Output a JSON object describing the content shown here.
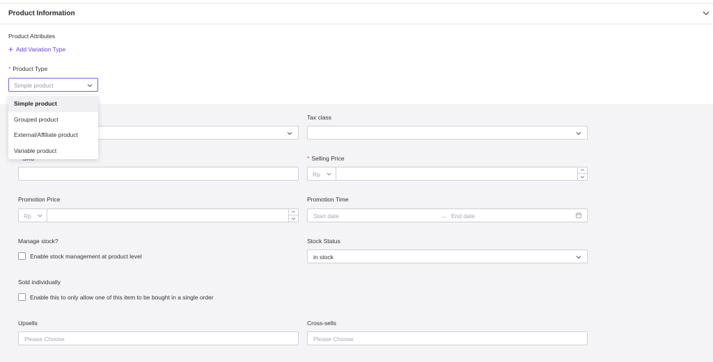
{
  "header": {
    "title": "Product Information"
  },
  "attributes": {
    "label": "Product Attributes",
    "add_variation": "Add Variation Type"
  },
  "product_type": {
    "label": "Product Type",
    "placeholder": "Simple product",
    "options": [
      "Simple product",
      "Grouped product",
      "External/Affiliate product",
      "Variable product"
    ],
    "highlighted": "Simple product"
  },
  "tax_class": {
    "label": "Tax class",
    "value": ""
  },
  "sku": {
    "label": "SKU",
    "value": ""
  },
  "selling_price": {
    "label": "Selling Price",
    "currency": "Rp",
    "value": ""
  },
  "promotion_price": {
    "label": "Promotion Price",
    "currency": "Rp",
    "value": ""
  },
  "promotion_time": {
    "label": "Promotion Time",
    "start_placeholder": "Start date",
    "arrow": "→",
    "end_placeholder": "End date"
  },
  "manage_stock": {
    "label": "Manage stock?",
    "checkbox_label": "Enable stock management at product level",
    "checked": false
  },
  "stock_status": {
    "label": "Stock Status",
    "value": "in stock"
  },
  "sold_individually": {
    "label": "Sold individually",
    "checkbox_label": "Enable this to only allow one of this item to be bought in a single order",
    "checked": false
  },
  "upsells": {
    "label": "Upsells",
    "placeholder": "Please Choose"
  },
  "cross_sells": {
    "label": "Cross-sells",
    "placeholder": "Please Choose"
  },
  "colors": {
    "accent": "#5b3fd6",
    "required": "#e5484d",
    "panel_bg": "#f4f4f6"
  }
}
